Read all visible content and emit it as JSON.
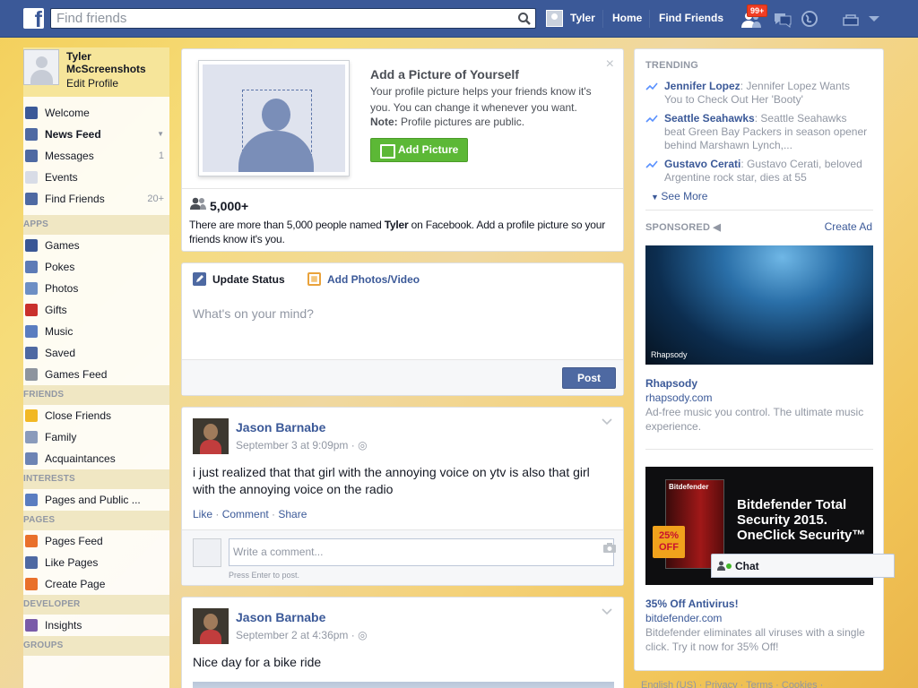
{
  "topbar": {
    "logo": "f",
    "search_placeholder": "Find friends",
    "user_name": "Tyler",
    "home_label": "Home",
    "find_friends_label": "Find Friends",
    "friend_requests_badge": "99+"
  },
  "left": {
    "profile_name": "Tyler McScreenshots",
    "edit_profile": "Edit Profile",
    "favorites": [
      {
        "label": "Welcome",
        "count": "",
        "color": "#3b5998"
      },
      {
        "label": "News Feed",
        "count": "",
        "color": "#4e69a2"
      },
      {
        "label": "Messages",
        "count": "1",
        "color": "#4e69a2"
      },
      {
        "label": "Events",
        "count": "",
        "color": "#d8dce6"
      },
      {
        "label": "Find Friends",
        "count": "20+",
        "color": "#4e69a2"
      }
    ],
    "apps_header": "APPS",
    "apps": [
      {
        "label": "Games",
        "color": "#3a5795"
      },
      {
        "label": "Pokes",
        "color": "#5d7bb6"
      },
      {
        "label": "Photos",
        "color": "#6d8fc4"
      },
      {
        "label": "Gifts",
        "color": "#c9302c"
      },
      {
        "label": "Music",
        "color": "#5a7dc0"
      },
      {
        "label": "Saved",
        "color": "#4e69a2"
      },
      {
        "label": "Games Feed",
        "color": "#8d949e"
      }
    ],
    "friends_header": "FRIENDS",
    "friends": [
      {
        "label": "Close Friends",
        "color": "#f2b824"
      },
      {
        "label": "Family",
        "color": "#8a9bbb"
      },
      {
        "label": "Acquaintances",
        "color": "#6d84b4"
      }
    ],
    "interests_header": "INTERESTS",
    "interests": [
      {
        "label": "Pages and Public ...",
        "color": "#5a7dc0"
      }
    ],
    "pages_header": "PAGES",
    "pages": [
      {
        "label": "Pages Feed",
        "color": "#e9702b"
      },
      {
        "label": "Like Pages",
        "color": "#4e69a2"
      },
      {
        "label": "Create Page",
        "color": "#e9702b"
      }
    ],
    "developer_header": "DEVELOPER",
    "developer": [
      {
        "label": "Insights",
        "color": "#7a5ba8"
      }
    ],
    "groups_header": "GROUPS"
  },
  "profile_prompt": {
    "title": "Add a Picture of Yourself",
    "desc": "Your profile picture helps your friends know it's you. You can change it whenever you want.",
    "note_bold": "Note:",
    "note_text": " Profile pictures are public.",
    "button": "Add Picture",
    "close": "×",
    "count": "5,000+",
    "people_text_pre": "There are more than 5,000 people named ",
    "people_name": "Tyler",
    "people_text_post": " on Facebook. Add a profile picture so your friends know it's you."
  },
  "composer": {
    "tab_status": "Update Status",
    "tab_photos": "Add Photos/Video",
    "placeholder": "What's on your mind?",
    "post_button": "Post"
  },
  "posts": [
    {
      "author": "Jason Barnabe",
      "time": "September 3 at 9:09pm · ◎",
      "text": "i just realized that that girl with the annoying voice on ytv is also that girl with the annoying voice on the radio",
      "like": "Like",
      "comment": "Comment",
      "share": "Share",
      "comment_placeholder": "Write a comment...",
      "comment_hint": "Press Enter to post."
    },
    {
      "author": "Jason Barnabe",
      "time": "September 2 at 4:36pm · ◎",
      "text": "Nice day for a bike ride"
    }
  ],
  "right": {
    "trending_header": "TRENDING",
    "trending": [
      {
        "name": "Jennifer Lopez",
        "text": ": Jennifer Lopez Wants You to Check Out Her 'Booty'"
      },
      {
        "name": "Seattle Seahawks",
        "text": ": Seattle Seahawks beat Green Bay Packers in season opener behind Marshawn Lynch,..."
      },
      {
        "name": "Gustavo Cerati",
        "text": ": Gustavo Cerati, beloved Argentine rock star, dies at 55"
      }
    ],
    "see_more": "See More",
    "sponsored_header": "SPONSORED",
    "create_ad": "Create Ad",
    "ad1": {
      "logo": "Rhapsody",
      "title": "Rhapsody",
      "url": "rhapsody.com",
      "desc": "Ad-free music you control. The ultimate music experience."
    },
    "ad2": {
      "brand": "Bitdefender",
      "image_title": "Bitdefender Total Security 2015. OneClick Security™",
      "off": "25% OFF",
      "title": "35% Off Antivirus!",
      "url": "bitdefender.com",
      "desc": "Bitdefender eliminates all viruses with a single click. Try it now for 35% Off!"
    }
  },
  "chat": {
    "label": "Chat"
  },
  "footer": {
    "text": "English (US) · Privacy · Terms · Cookies ·"
  }
}
